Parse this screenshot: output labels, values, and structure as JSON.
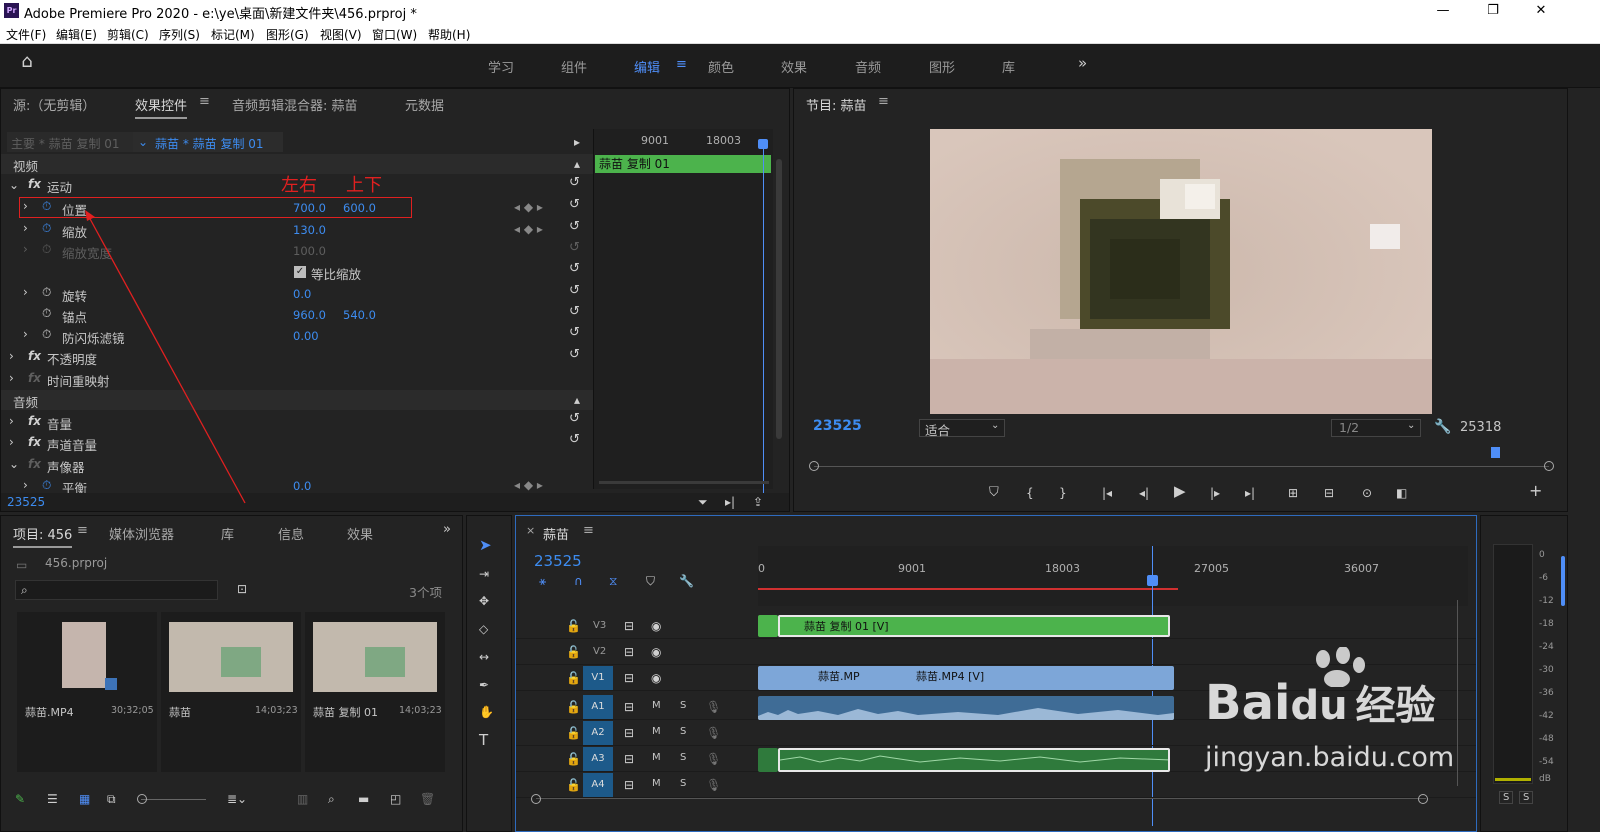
{
  "window": {
    "title": "Adobe Premiere Pro 2020 - e:\\ye\\桌面\\新建文件夹\\456.prproj *",
    "logo": "Pr"
  },
  "menu": [
    "文件(F)",
    "编辑(E)",
    "剪辑(C)",
    "序列(S)",
    "标记(M)",
    "图形(G)",
    "视图(V)",
    "窗口(W)",
    "帮助(H)"
  ],
  "workspaces": [
    "学习",
    "组件",
    "编辑",
    "颜色",
    "效果",
    "音频",
    "图形",
    "库"
  ],
  "workspace_active": "编辑",
  "effect_panel": {
    "tabs": [
      "源:（无剪辑）",
      "效果控件",
      "音频剪辑混合器: 蒜苗",
      "元数据"
    ],
    "master_label": "主要 * 蒜苗 复制 01",
    "clip_label": "蒜苗 * 蒜苗 复制 01",
    "ruler": [
      "9001",
      "18003"
    ],
    "clip_bar": "蒜苗 复制 01",
    "video_header": "视频",
    "motion": "运动",
    "annotation_lr": "左右",
    "annotation_ud": "上下",
    "rows": [
      {
        "name": "位置",
        "v1": "700.0",
        "v2": "600.0"
      },
      {
        "name": "缩放",
        "v1": "130.0"
      },
      {
        "name": "缩放宽度",
        "v1": "100.0"
      },
      {
        "name": "等比缩放"
      },
      {
        "name": "旋转",
        "v1": "0.0"
      },
      {
        "name": "锚点",
        "v1": "960.0",
        "v2": "540.0"
      },
      {
        "name": "防闪烁滤镜",
        "v1": "0.00"
      }
    ],
    "opacity": "不透明度",
    "time_remap": "时间重映射",
    "audio_header": "音频",
    "volume": "音量",
    "channel_volume": "声道音量",
    "panner": "声像器",
    "balance": "平衡",
    "balance_val": "0.0",
    "timecode": "23525"
  },
  "program": {
    "title": "节目: 蒜苗",
    "timecode": "23525",
    "fit": "适合",
    "quality": "1/2",
    "duration": "25318"
  },
  "project": {
    "tabs": [
      "项目: 456",
      "媒体浏览器",
      "库",
      "信息",
      "效果"
    ],
    "file": "456.prproj",
    "count": "3个项",
    "items": [
      {
        "name": "蒜苗.MP4",
        "dur": "30;32;05"
      },
      {
        "name": "蒜苗",
        "dur": "14;03;23"
      },
      {
        "name": "蒜苗 复制 01",
        "dur": "14;03;23"
      }
    ]
  },
  "timeline": {
    "title": "蒜苗",
    "timecode": "23525",
    "ruler": [
      "0",
      "9001",
      "18003",
      "27005",
      "36007"
    ],
    "tracks": [
      "V3",
      "V2",
      "V1",
      "A1",
      "A2",
      "A3",
      "A4"
    ],
    "clip_v3": "蒜苗 复制 01 [V]",
    "clip_v1a": "蒜苗.MP",
    "clip_v1b": "蒜苗.MP4 [V]",
    "m": "M",
    "s": "S"
  },
  "meter": {
    "labels": [
      "0",
      "-6",
      "-12",
      "-18",
      "-24",
      "-30",
      "-36",
      "-42",
      "-48",
      "-54",
      "dB"
    ],
    "s": "S"
  },
  "watermark": {
    "text1": "Bai",
    "text2": "du",
    "text3": "经验",
    "url": "jingyan.baidu.com"
  },
  "colors": {
    "accent": "#3d8cf0",
    "clip_green": "#4cb34c",
    "clip_blue": "#7da6d8",
    "audio_green": "#2f7a3c",
    "annotation": "#e02020"
  }
}
